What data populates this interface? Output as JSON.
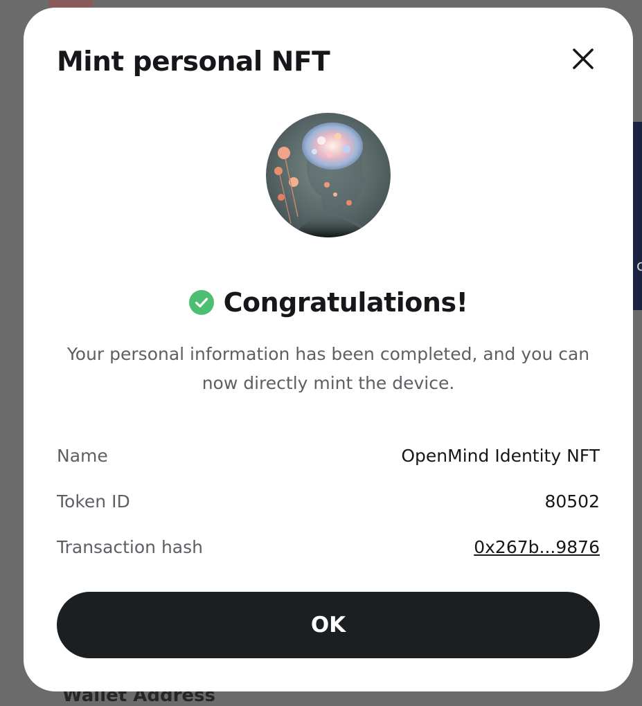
{
  "background": {
    "wallet_label": "Wallet Address",
    "panel_glyph": "c"
  },
  "modal": {
    "title": "Mint personal NFT",
    "close_icon": "close-icon",
    "image_icon": "nft-avatar-brain-flowers",
    "success": {
      "icon": "check-circle-icon",
      "title": "Congratulations!"
    },
    "description": "Your personal information has been completed, and you can now directly mint the device.",
    "details": [
      {
        "label": "Name",
        "value": "OpenMind Identity NFT"
      },
      {
        "label": "Token ID",
        "value": "80502"
      },
      {
        "label": "Transaction hash",
        "value": "0x267b...9876"
      }
    ],
    "ok_label": "OK"
  },
  "colors": {
    "accent_success": "#4cbf73",
    "button_bg": "#1c1f22",
    "title_text": "#15171a",
    "muted_text": "#5c5f64"
  }
}
